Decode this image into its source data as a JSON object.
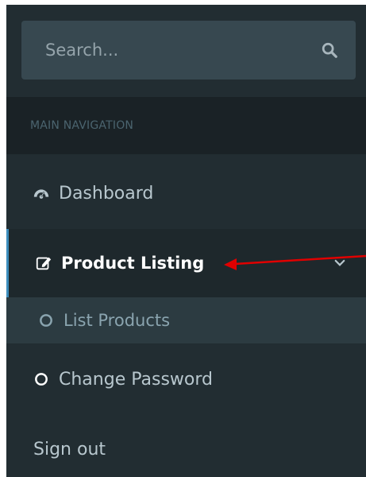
{
  "search": {
    "placeholder": "Search..."
  },
  "nav": {
    "header": "MAIN NAVIGATION",
    "items": [
      {
        "label": "Dashboard",
        "icon": "dashboard-icon"
      },
      {
        "label": "Product Listing",
        "icon": "edit-icon",
        "expanded": true
      },
      {
        "label": "List Products",
        "icon": "circle-icon"
      },
      {
        "label": "Change Password",
        "icon": "circle-icon"
      },
      {
        "label": "Sign out"
      }
    ]
  },
  "colors": {
    "sidebar_bg": "#222d32",
    "header_bg": "#1a2226",
    "active_bg": "#1e282c",
    "submenu_bg": "#2c3b41",
    "search_bg": "#374850",
    "text": "#b8c7ce",
    "annotation_arrow": "#e00000"
  }
}
